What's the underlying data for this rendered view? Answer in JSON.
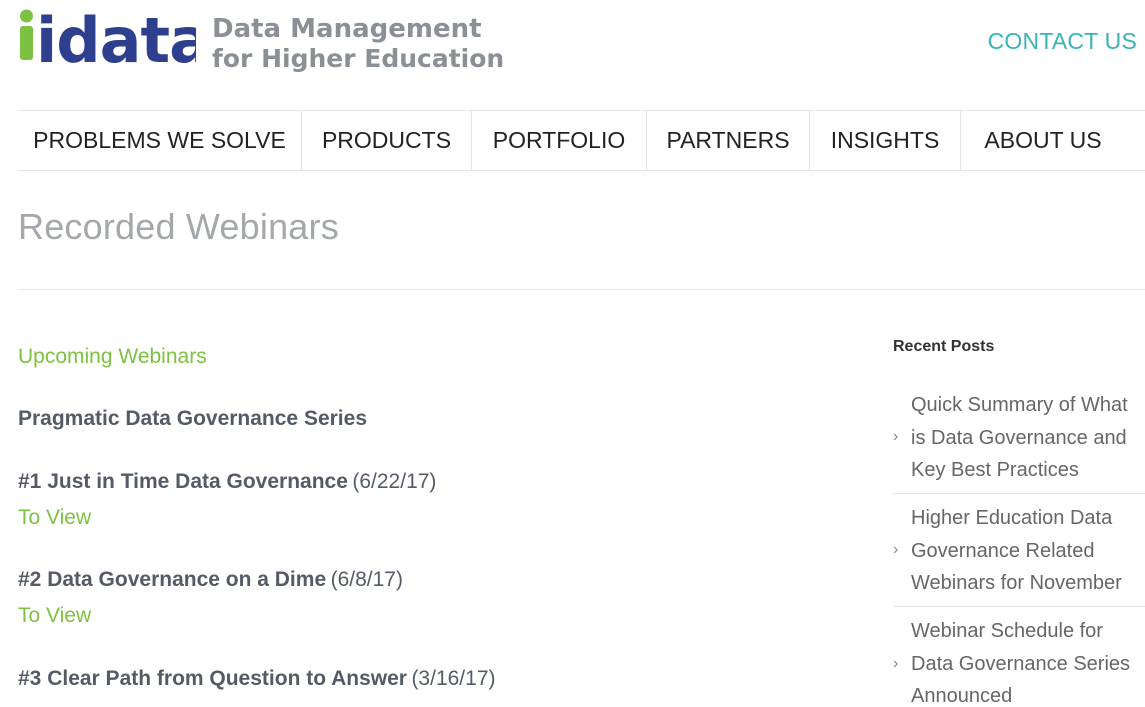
{
  "brand": {
    "logo_text": "idata",
    "tagline_line1": "Data Management",
    "tagline_line2": "for Higher Education",
    "colors": {
      "green": "#7cc142",
      "navy": "#2e3f8e",
      "teal": "#3ab3b8",
      "gray": "#8b8f96"
    }
  },
  "header": {
    "contact_label": "CONTACT US"
  },
  "nav": {
    "items": [
      {
        "label": "PROBLEMS WE SOLVE"
      },
      {
        "label": "PRODUCTS"
      },
      {
        "label": "PORTFOLIO"
      },
      {
        "label": "PARTNERS"
      },
      {
        "label": "INSIGHTS"
      },
      {
        "label": "ABOUT US"
      }
    ]
  },
  "page": {
    "title": "Recorded Webinars"
  },
  "main": {
    "upcoming_link": "Upcoming Webinars",
    "series_heading": "Pragmatic Data Governance Series",
    "entries": [
      {
        "title": "#1 Just in Time Data Governance",
        "date": "(6/22/17)",
        "link": "To View"
      },
      {
        "title": "#2 Data Governance on a Dime",
        "date": "(6/8/17)",
        "link": "To View"
      },
      {
        "title": "#3 Clear Path from Question to Answer",
        "date": "(3/16/17)"
      }
    ]
  },
  "sidebar": {
    "title": "Recent Posts",
    "chevron_icon": "chevron-right-icon",
    "posts": [
      {
        "lines": [
          "Quick Summary of What",
          "is Data Governance and",
          "Key Best Practices"
        ]
      },
      {
        "lines": [
          "Higher Education Data",
          "Governance Related",
          "Webinars for November"
        ]
      },
      {
        "lines": [
          "Webinar Schedule for",
          "Data Governance Series",
          "Announced"
        ]
      }
    ]
  }
}
